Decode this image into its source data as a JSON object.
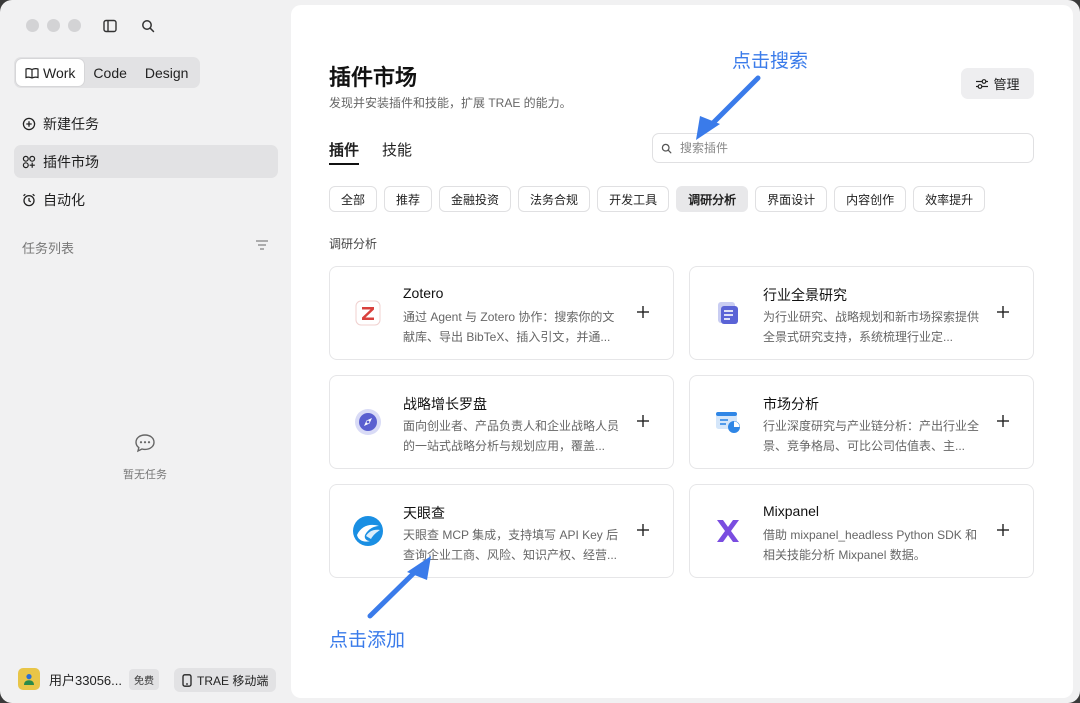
{
  "sidebar": {
    "segments": [
      "Work",
      "Code",
      "Design"
    ],
    "nav": {
      "new_task": "新建任务",
      "plugin_market": "插件市场",
      "automation": "自动化"
    },
    "task_list_title": "任务列表",
    "empty_text": "暂无任务",
    "user": {
      "name": "用户33056...",
      "plan": "免费"
    },
    "mobile_label": "TRAE 移动端"
  },
  "main": {
    "title": "插件市场",
    "subtitle": "发现并安装插件和技能，扩展 TRAE 的能力。",
    "manage_label": "管理",
    "tabs": [
      "插件",
      "技能"
    ],
    "search_placeholder": "搜索插件",
    "chips": [
      "全部",
      "推荐",
      "金融投资",
      "法务合规",
      "开发工具",
      "调研分析",
      "界面设计",
      "内容创作",
      "效率提升"
    ],
    "active_chip": "调研分析",
    "section_title": "调研分析",
    "cards": [
      {
        "name": "Zotero",
        "desc": "通过 Agent 与 Zotero 协作：搜索你的文献库、导出 BibTeX、插入引文，并通...",
        "icon": "zotero-icon"
      },
      {
        "name": "行业全景研究",
        "desc": "为行业研究、战略规划和新市场探索提供全景式研究支持，系统梳理行业定...",
        "icon": "document-stack-icon"
      },
      {
        "name": "战略增长罗盘",
        "desc": "面向创业者、产品负责人和企业战略人员的一站式战略分析与规划应用，覆盖...",
        "icon": "compass-icon"
      },
      {
        "name": "市场分析",
        "desc": "行业深度研究与产业链分析：产出行业全景、竞争格局、可比公司估值表、主...",
        "icon": "chart-window-icon"
      },
      {
        "name": "天眼查",
        "desc": "天眼查 MCP 集成，支持填写 API Key 后查询企业工商、风险、知识产权、经营...",
        "icon": "tianyancha-icon"
      },
      {
        "name": "Mixpanel",
        "desc": "借助 mixpanel_headless Python SDK 和相关技能分析 Mixpanel 数据。",
        "icon": "mixpanel-icon"
      }
    ]
  },
  "annotations": {
    "search_hint": "点击搜索",
    "add_hint": "点击添加"
  },
  "colors": {
    "annotation": "#3a7bea",
    "avatar": "#e8c548",
    "zotero_red": "#d9413d",
    "mixpanel_purple": "#7a4de0"
  }
}
